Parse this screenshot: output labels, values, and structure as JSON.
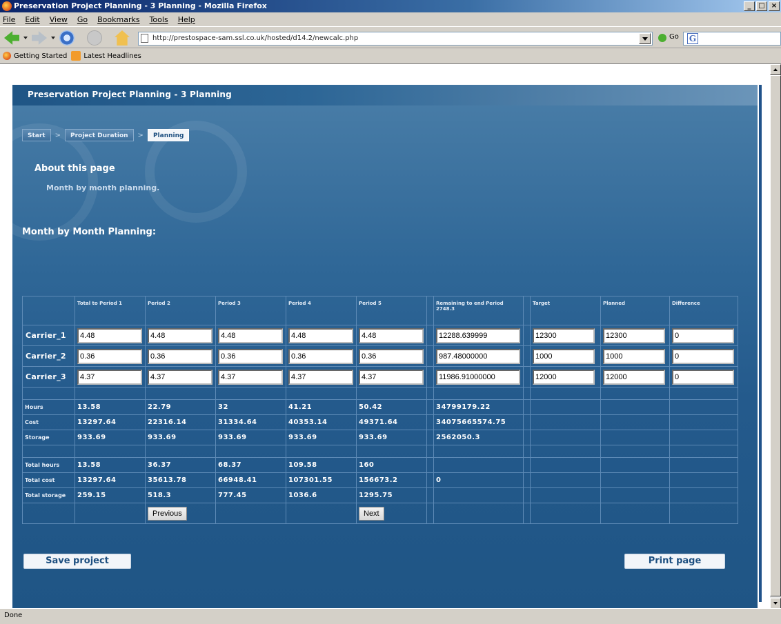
{
  "window": {
    "title": "Preservation Project Planning - 3 Planning - Mozilla Firefox",
    "controls": [
      "_",
      "□",
      "×"
    ]
  },
  "menu": [
    "File",
    "Edit",
    "View",
    "Go",
    "Bookmarks",
    "Tools",
    "Help"
  ],
  "toolbar": {
    "url": "http://prestospace-sam.ssl.co.uk/hosted/d14.2/newcalc.php",
    "go_label": "Go",
    "search_engine_glyph": "G"
  },
  "bookmarks": [
    "Getting Started",
    "Latest Headlines"
  ],
  "page": {
    "title": "Preservation Project Planning - 3 Planning",
    "breadcrumb": [
      "Start",
      "Project Duration",
      "Planning"
    ],
    "about_title": "About this page",
    "about_text": "Month by month planning.",
    "section_title": "Month by Month Planning:",
    "columns": [
      "Total to Period 1",
      "Period 2",
      "Period 3",
      "Period 4",
      "Period 5",
      "Remaining to end Period 2748.3",
      "Target",
      "Planned",
      "Difference"
    ],
    "carriers": [
      {
        "name": "Carrier_1",
        "values": [
          "4.48",
          "4.48",
          "4.48",
          "4.48",
          "4.48",
          "12288.639999",
          "12300",
          "12300",
          "0"
        ]
      },
      {
        "name": "Carrier_2",
        "values": [
          "0.36",
          "0.36",
          "0.36",
          "0.36",
          "0.36",
          "987.48000000",
          "1000",
          "1000",
          "0"
        ]
      },
      {
        "name": "Carrier_3",
        "values": [
          "4.37",
          "4.37",
          "4.37",
          "4.37",
          "4.37",
          "11986.91000000",
          "12000",
          "12000",
          "0"
        ]
      }
    ],
    "period_rows": [
      {
        "label": "Hours",
        "values": [
          "13.58",
          "22.79",
          "32",
          "41.21",
          "50.42",
          "34799179.22"
        ]
      },
      {
        "label": "Cost",
        "values": [
          "13297.64",
          "22316.14",
          "31334.64",
          "40353.14",
          "49371.64",
          "34075665574.75"
        ]
      },
      {
        "label": "Storage",
        "values": [
          "933.69",
          "933.69",
          "933.69",
          "933.69",
          "933.69",
          "2562050.3"
        ]
      }
    ],
    "total_rows": [
      {
        "label": "Total hours",
        "values": [
          "13.58",
          "36.37",
          "68.37",
          "109.58",
          "160",
          ""
        ]
      },
      {
        "label": "Total cost",
        "values": [
          "13297.64",
          "35613.78",
          "66948.41",
          "107301.55",
          "156673.2",
          "0"
        ]
      },
      {
        "label": "Total storage",
        "values": [
          "259.15",
          "518.3",
          "777.45",
          "1036.6",
          "1295.75",
          ""
        ]
      }
    ],
    "previous_label": "Previous",
    "next_label": "Next",
    "save_label": "Save project",
    "print_label": "Print page"
  },
  "status": "Done"
}
